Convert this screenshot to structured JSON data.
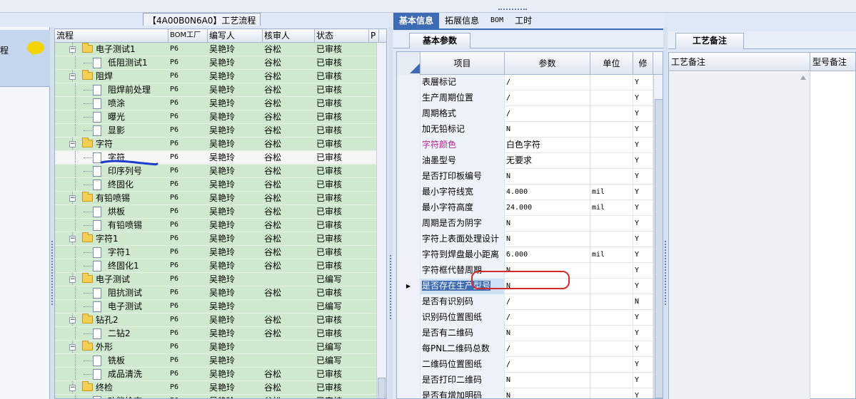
{
  "leftmost": {
    "label": "程"
  },
  "tree": {
    "title": "【4A00B0N6A0】工艺流程",
    "columns": [
      "流程",
      "BOM工厂",
      "编写人",
      "核审人",
      "状态",
      "P"
    ],
    "rows": [
      {
        "name": "电子测试1",
        "type": "folder",
        "level": 0,
        "bom": "P6",
        "writer": "吴艳玲",
        "reviewer": "谷松",
        "status": "已审核"
      },
      {
        "name": "低阻测试1",
        "type": "doc",
        "level": 1,
        "bom": "P6",
        "writer": "吴艳玲",
        "reviewer": "谷松",
        "status": "已审核"
      },
      {
        "name": "阻焊",
        "type": "folder",
        "level": 0,
        "bom": "P6",
        "writer": "吴艳玲",
        "reviewer": "谷松",
        "status": "已审核"
      },
      {
        "name": "阻焊前处理",
        "type": "doc",
        "level": 1,
        "bom": "P6",
        "writer": "吴艳玲",
        "reviewer": "谷松",
        "status": "已审核"
      },
      {
        "name": "喷涂",
        "type": "doc",
        "level": 1,
        "bom": "P6",
        "writer": "吴艳玲",
        "reviewer": "谷松",
        "status": "已审核"
      },
      {
        "name": "曝光",
        "type": "doc",
        "level": 1,
        "bom": "P6",
        "writer": "吴艳玲",
        "reviewer": "谷松",
        "status": "已审核"
      },
      {
        "name": "显影",
        "type": "doc",
        "level": 1,
        "bom": "P6",
        "writer": "吴艳玲",
        "reviewer": "谷松",
        "status": "已审核"
      },
      {
        "name": "字符",
        "type": "folder",
        "level": 0,
        "bom": "P6",
        "writer": "吴艳玲",
        "reviewer": "谷松",
        "status": "已审核"
      },
      {
        "name": "字符",
        "type": "doc",
        "level": 1,
        "bom": "P6",
        "writer": "吴艳玲",
        "reviewer": "谷松",
        "status": "已审核",
        "selected": true
      },
      {
        "name": "印序列号",
        "type": "doc",
        "level": 1,
        "bom": "P6",
        "writer": "吴艳玲",
        "reviewer": "谷松",
        "status": "已审核"
      },
      {
        "name": "终固化",
        "type": "doc",
        "level": 1,
        "bom": "P6",
        "writer": "吴艳玲",
        "reviewer": "谷松",
        "status": "已审核"
      },
      {
        "name": "有铅喷锡",
        "type": "folder",
        "level": 0,
        "bom": "P6",
        "writer": "吴艳玲",
        "reviewer": "谷松",
        "status": "已审核"
      },
      {
        "name": "烘板",
        "type": "doc",
        "level": 1,
        "bom": "P6",
        "writer": "吴艳玲",
        "reviewer": "谷松",
        "status": "已审核"
      },
      {
        "name": "有铅喷锡",
        "type": "doc",
        "level": 1,
        "bom": "P6",
        "writer": "吴艳玲",
        "reviewer": "谷松",
        "status": "已审核"
      },
      {
        "name": "字符1",
        "type": "folder",
        "level": 0,
        "bom": "P6",
        "writer": "吴艳玲",
        "reviewer": "谷松",
        "status": "已审核"
      },
      {
        "name": "字符1",
        "type": "doc",
        "level": 1,
        "bom": "P6",
        "writer": "吴艳玲",
        "reviewer": "谷松",
        "status": "已审核"
      },
      {
        "name": "终固化1",
        "type": "doc",
        "level": 1,
        "bom": "P6",
        "writer": "吴艳玲",
        "reviewer": "谷松",
        "status": "已审核"
      },
      {
        "name": "电子测试",
        "type": "folder",
        "level": 0,
        "bom": "P6",
        "writer": "吴艳玲",
        "reviewer": "",
        "status": "已编写"
      },
      {
        "name": "阻抗测试",
        "type": "doc",
        "level": 1,
        "bom": "P6",
        "writer": "吴艳玲",
        "reviewer": "谷松",
        "status": "已审核"
      },
      {
        "name": "电子测试",
        "type": "doc",
        "level": 1,
        "bom": "P6",
        "writer": "吴艳玲",
        "reviewer": "",
        "status": "已编写"
      },
      {
        "name": "钻孔2",
        "type": "folder",
        "level": 0,
        "bom": "P6",
        "writer": "吴艳玲",
        "reviewer": "谷松",
        "status": "已审核"
      },
      {
        "name": "二钻2",
        "type": "doc",
        "level": 1,
        "bom": "P6",
        "writer": "吴艳玲",
        "reviewer": "谷松",
        "status": "已审核"
      },
      {
        "name": "外形",
        "type": "folder",
        "level": 0,
        "bom": "P6",
        "writer": "吴艳玲",
        "reviewer": "",
        "status": "已编写"
      },
      {
        "name": "铣板",
        "type": "doc",
        "level": 1,
        "bom": "P6",
        "writer": "吴艳玲",
        "reviewer": "",
        "status": "已编写"
      },
      {
        "name": "成品清洗",
        "type": "doc",
        "level": 1,
        "bom": "P6",
        "writer": "吴艳玲",
        "reviewer": "谷松",
        "status": "已审核"
      },
      {
        "name": "终检",
        "type": "folder",
        "level": 0,
        "bom": "P6",
        "writer": "吴艳玲",
        "reviewer": "谷松",
        "status": "已审核"
      },
      {
        "name": "功能检查",
        "type": "doc",
        "level": 1,
        "bom": "P6",
        "writer": "吴艳玲",
        "reviewer": "谷松",
        "status": "已审核"
      }
    ]
  },
  "center": {
    "tabs": [
      "基本信息",
      "拓展信息",
      "BOM",
      "工时"
    ],
    "active_tab": "基本信息",
    "sub_tab": "基本参数",
    "columns": [
      "项目",
      "参数",
      "单位",
      "修"
    ],
    "rows": [
      {
        "item": "表層标记",
        "param": "/",
        "unit": "",
        "flag": "Y"
      },
      {
        "item": "生产周期位置",
        "param": "/",
        "unit": "",
        "flag": "Y"
      },
      {
        "item": "周期格式",
        "param": "/",
        "unit": "",
        "flag": "Y"
      },
      {
        "item": "加无铅标记",
        "param": "N",
        "unit": "",
        "flag": "Y"
      },
      {
        "item": "字符颜色",
        "param": "白色字符",
        "unit": "",
        "flag": "Y",
        "highlight": true
      },
      {
        "item": "油墨型号",
        "param": "无要求",
        "unit": "",
        "flag": "Y"
      },
      {
        "item": "是否打印板编号",
        "param": "N",
        "unit": "",
        "flag": "Y"
      },
      {
        "item": "最小字符线宽",
        "param": "4.000",
        "unit": "mil",
        "flag": "Y"
      },
      {
        "item": "最小字符高度",
        "param": "24.000",
        "unit": "mil",
        "flag": "Y"
      },
      {
        "item": "周期是否为阴字",
        "param": "N",
        "unit": "",
        "flag": "Y"
      },
      {
        "item": "字符上表面处理设计",
        "param": "N",
        "unit": "",
        "flag": "Y"
      },
      {
        "item": "字符到焊盘最小距离",
        "param": "6.000",
        "unit": "mil",
        "flag": "Y"
      },
      {
        "item": "字符框代替周期",
        "param": "N",
        "unit": "",
        "flag": "Y"
      },
      {
        "item": "是否存在生产型号",
        "param": "N",
        "unit": "",
        "flag": "Y",
        "current": true
      },
      {
        "item": "是否有识别码",
        "param": "/",
        "unit": "",
        "flag": "N"
      },
      {
        "item": "识别码位置图纸",
        "param": "/",
        "unit": "",
        "flag": "Y"
      },
      {
        "item": "是否有二维码",
        "param": "N",
        "unit": "",
        "flag": "Y"
      },
      {
        "item": "每PNL二维码总数",
        "param": "/",
        "unit": "",
        "flag": "Y"
      },
      {
        "item": "二维码位置图纸",
        "param": "/",
        "unit": "",
        "flag": "Y"
      },
      {
        "item": "是否打印二维码",
        "param": "N",
        "unit": "",
        "flag": "Y"
      },
      {
        "item": "是否有增加明码",
        "param": "N",
        "unit": "",
        "flag": "Y"
      }
    ]
  },
  "right": {
    "tab": "工艺备注",
    "columns": [
      "工艺备注",
      "型号备注"
    ]
  },
  "colors": {
    "tree_row_bg": "#cfe9cf",
    "highlight_text": "#c0209a",
    "selection_blue": "#3d6bb5",
    "annotation_red": "#d42a2a",
    "annotation_blue": "#1a3cc8"
  }
}
